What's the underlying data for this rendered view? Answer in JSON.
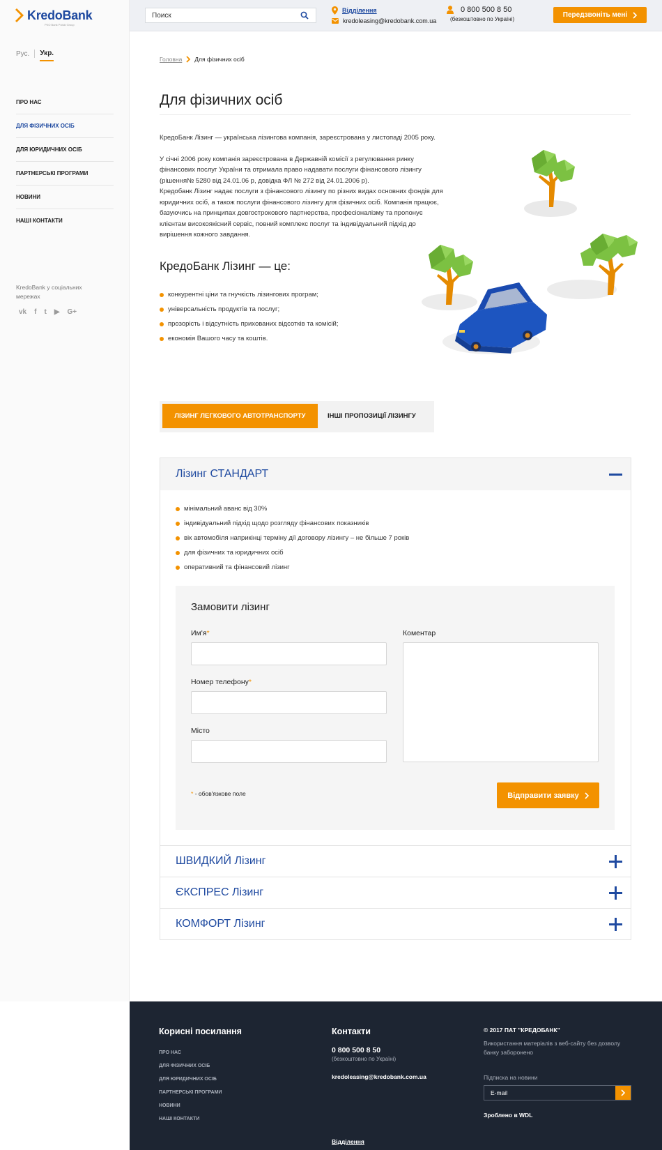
{
  "brand": {
    "name": "KredoBank",
    "tagline": "PKO Bank Polski Group",
    "accent": "#f39200",
    "primary": "#1f4aa0"
  },
  "lang": {
    "ru": "Рус.",
    "uk": "Укр."
  },
  "sidebar": {
    "items": [
      {
        "label": "ПРО НАС"
      },
      {
        "label": "ДЛЯ ФІЗИЧНИХ ОСІБ"
      },
      {
        "label": "ДЛЯ ЮРИДИЧНИХ ОСІБ"
      },
      {
        "label": "ПАРТНЕРСЬКІ ПРОГРАМИ"
      },
      {
        "label": "НОВИНИ"
      },
      {
        "label": "НАШІ КОНТАКТИ"
      }
    ],
    "social_text": "KredoBank у соціальних мережах",
    "social_icons": [
      "vk-icon",
      "facebook-icon",
      "twitter-icon",
      "youtube-icon",
      "googleplus-icon"
    ],
    "social_glyphs": {
      "vk": "vk",
      "fb": "f",
      "tw": "t",
      "yt": "▶",
      "gp": "G+"
    }
  },
  "header": {
    "search_placeholder": "Поиск",
    "branch_label": "Відділення",
    "email": "kredoleasing@kredobank.com.ua",
    "phone": "0 800 500 8 50",
    "phone_note": "(безкоштовно по Україні)",
    "callback_label": "Передзвоніть мені"
  },
  "breadcrumb": {
    "home": "Головна",
    "current": "Для фізичних осіб"
  },
  "page": {
    "title": "Для фізичних осіб",
    "intro_1": "КредоБанк Лізинг — українська лізингова компанія, зареєстрована у листопаді 2005 року.",
    "intro_2": "У січні 2006 року компанія зареєстрована в Державній комісії з регулювання ринку фінансових послуг України та отримала право надавати послуги фінансового лізингу (рішення№ 5280 від 24.01.06 р, довідка ФЛ № 272 від 24.01.2006 р).",
    "intro_3": "Кредобанк Лізинг надає послуги з фінансового лізингу по різних видах основних фондів для юридичних осіб, а також послуги фінансового лізингу для фізичних осіб. Компанія працює, базуючись на принципах довгострокового партнерства, професіоналізму та пропонує клієнтам високоякісний сервіс, повний комплекс послуг та індивідуальний підхід до вирішення кожного завдання.",
    "subtitle": "КредоБанк Лізинг — це:",
    "benefits": [
      "конкурентні ціни та гнучкість лізингових програм;",
      "універсальність продуктів та послуг;",
      "прозорість і відсутність прихованих відсотків та комісій;",
      "економія Вашого часу та коштів."
    ]
  },
  "tabs": {
    "active": "ЛІЗИНГ ЛЕГКОВОГО АВТОТРАНСПОРТУ",
    "other": "ІНШІ ПРОПОЗИЦІЇ ЛІЗИНГУ"
  },
  "accordion": {
    "open_title": "Лізинг СТАНДАРТ",
    "features": [
      "мінімальний аванс від 30%",
      "індивідуальний підхід щодо розгляду фінансових показників",
      "вік автомобіля наприкінці терміну дії договору лізингу – не більше 7 років",
      "для фізичних та юридичних осіб",
      "оперативний та фінансовий лізинг"
    ],
    "form": {
      "title": "Замовити лізинг",
      "name_label": "Им'я",
      "phone_label": "Номер телефону",
      "city_label": "Місто",
      "comment_label": "Коментар",
      "required_mark": "*",
      "required_note": "- обов'язкове поле",
      "submit_label": "Відправити заявку"
    },
    "closed": [
      "ШВИДКИЙ Лізинг",
      "ЄКСПРЕС Лізинг",
      "КОМФОРТ Лізинг"
    ]
  },
  "footer": {
    "links_title": "Корисні посилання",
    "links": [
      "ПРО НАС",
      "ДЛЯ ФІЗИЧНИХ ОСІБ",
      "ДЛЯ ЮРИДИЧНИХ ОСІБ",
      "ПАРТНЕРСЬКІ ПРОГРАМИ",
      "НОВИНИ",
      "НАШІ КОНТАКТИ"
    ],
    "contacts_title": "Контакти",
    "phone": "0 800 500 8 50",
    "phone_note": "(безкоштовно по Україні)",
    "email": "kredoleasing@kredobank.com.ua",
    "branch": "Відділення",
    "copyright": "© 2017 ПАТ \"КРЕДОБАНК\"",
    "usage_note": "Використання матеріалів з веб-сайту без дозволу банку заборонено",
    "subscribe_label": "Підписка на новини",
    "email_placeholder": "E-mail",
    "made_by": "Зроблено в   WDL"
  }
}
